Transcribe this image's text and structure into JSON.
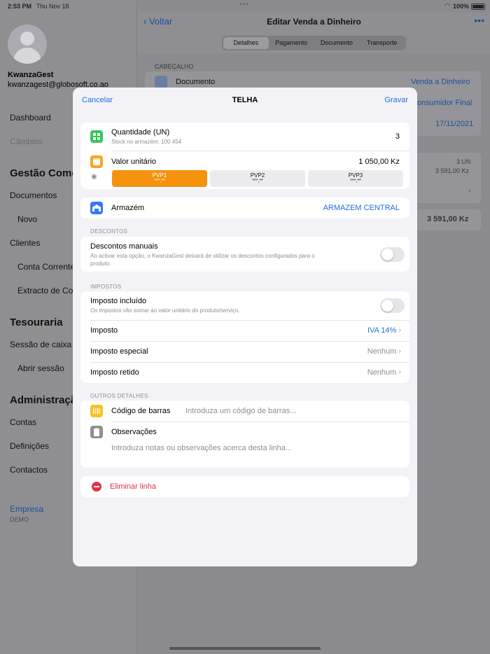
{
  "status_bar": {
    "time": "2:53 PM",
    "date": "Thu Nov 18",
    "battery": "100%"
  },
  "sidebar": {
    "user_name": "KwanzaGest",
    "user_email": "kwanzagest@globosoft.co.ao",
    "items": {
      "dashboard": "Dashboard",
      "cambios": "Câmbios",
      "gestao": "Gestão Come",
      "documentos": "Documentos",
      "novo": "Novo",
      "clientes": "Clientes",
      "conta_corrente": "Conta Corrente",
      "extracto": "Extracto de Con",
      "tesouraria": "Tesouraria",
      "sessao_caixa": "Sessão de caixa",
      "abrir_sessao": "Abrir sessão",
      "administracao": "Administraçã",
      "contas": "Contas",
      "definicoes": "Definições",
      "contactos": "Contactos"
    },
    "empresa": "Empresa",
    "demo": "DEMO"
  },
  "main": {
    "back": "Voltar",
    "title": "Editar Venda a Dinheiro",
    "tabs": [
      "Detalhes",
      "Pagamento",
      "Documento",
      "Transporte"
    ],
    "cabecalho": "CABEÇALHO",
    "documento_label": "Documento",
    "documento_value": "Venda a Dinheiro",
    "cliente_value": "onsumidor Final",
    "data_value": "17/11/2021",
    "qty_un": "3 UN",
    "qty_amount": "3 591,00 Kz",
    "total": "3 591,00 Kz"
  },
  "modal": {
    "cancel": "Cancelar",
    "title": "TELHA",
    "save": "Gravar",
    "quantidade_label": "Quantidade (UN)",
    "stock_label": "Stock no armazém: 100 454",
    "quantidade_value": "3",
    "valor_label": "Valor unitário",
    "valor_value": "1 050,00 Kz",
    "pvp": [
      {
        "label": "PVP1",
        "value": "***,**"
      },
      {
        "label": "PVP2",
        "value": "***,**"
      },
      {
        "label": "PVP3",
        "value": "***,**"
      }
    ],
    "armazem_label": "Armazém",
    "armazem_value": "ARMAZEM CENTRAL",
    "descontos_header": "DESCONTOS",
    "descontos_label": "Descontos manuais",
    "descontos_desc": "Ao activar esta opção, o KwanzaGest deixará de utilizar os descontos configurados para o",
    "descontos_desc2": "produto.",
    "impostos_header": "IMPOSTOS",
    "imposto_incluido_label": "Imposto incluído",
    "imposto_incluido_desc": "Os impostos vão somar ao valor unitário do produto/serviço.",
    "imposto_label": "Imposto",
    "imposto_value": "IVA 14%",
    "imposto_especial_label": "Imposto especial",
    "imposto_especial_value": "Nenhum",
    "imposto_retido_label": "Imposto retido",
    "imposto_retido_value": "Nenhum",
    "outros_header": "OUTROS DETALHES",
    "codigo_label": "Código de barras",
    "codigo_placeholder": "Introduza um código de barras...",
    "observacoes_label": "Observações",
    "observacoes_placeholder": "Introduza notas ou observações acerca desta linha...",
    "eliminar": "Eliminar linha"
  },
  "colors": {
    "accent": "#1f6fdc",
    "pvp_active": "#f5930e",
    "danger": "#e0334a",
    "green_icon": "#34c759"
  },
  "icons": [
    "back-chevron-icon",
    "more-icon",
    "document-icon",
    "quantity-icon",
    "price-icon",
    "eye-icon",
    "warehouse-icon",
    "barcode-icon",
    "clipboard-icon",
    "minus-circle-icon",
    "chevron-right-icon"
  ]
}
